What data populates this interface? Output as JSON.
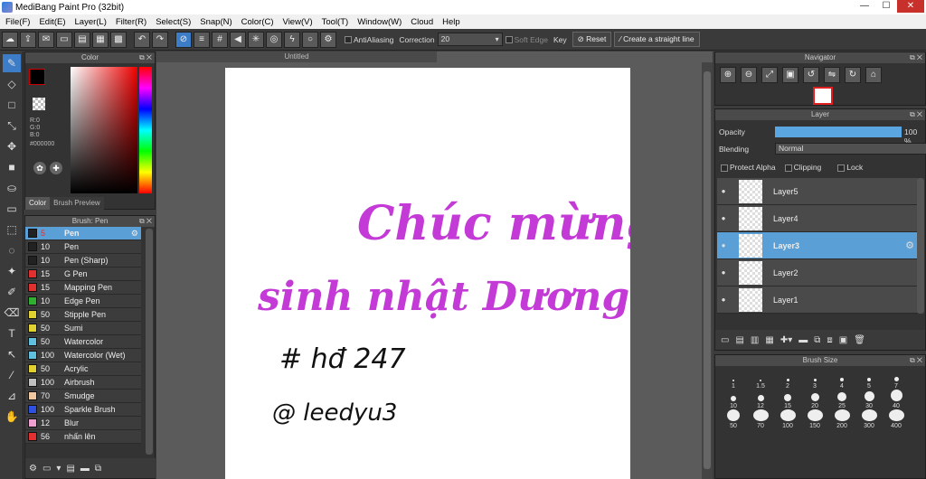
{
  "window": {
    "title": "MediBang Paint Pro (32bit)",
    "min": "—",
    "max": "☐",
    "close": "✕"
  },
  "menu": [
    "File(F)",
    "Edit(E)",
    "Layer(L)",
    "Filter(R)",
    "Select(S)",
    "Snap(N)",
    "Color(C)",
    "View(V)",
    "Tool(T)",
    "Window(W)",
    "Cloud",
    "Help"
  ],
  "toolbar": {
    "antialiasing": "AntiAliasing",
    "correction_label": "Correction",
    "correction_value": "20",
    "soft_edge": "Soft Edge",
    "key_label": "Key",
    "reset": "Reset",
    "straight_line": "Create a straight line"
  },
  "color_panel": {
    "title": "Color",
    "r": "R:0",
    "g": "G:0",
    "b": "B:0",
    "hex": "#000000",
    "tab_color": "Color",
    "tab_brush_preview": "Brush Preview"
  },
  "brush_panel": {
    "title": "Brush: Pen",
    "brushes": [
      {
        "size": "5",
        "name": "Pen",
        "color": "#222222"
      },
      {
        "size": "10",
        "name": "Pen",
        "color": "#222222"
      },
      {
        "size": "10",
        "name": "Pen (Sharp)",
        "color": "#222222"
      },
      {
        "size": "15",
        "name": "G Pen",
        "color": "#e03030"
      },
      {
        "size": "15",
        "name": "Mapping Pen",
        "color": "#e03030"
      },
      {
        "size": "10",
        "name": "Edge Pen",
        "color": "#30b030"
      },
      {
        "size": "50",
        "name": "Stipple Pen",
        "color": "#e0d030"
      },
      {
        "size": "50",
        "name": "Sumi",
        "color": "#e0d030"
      },
      {
        "size": "50",
        "name": "Watercolor",
        "color": "#60c0e0"
      },
      {
        "size": "100",
        "name": "Watercolor (Wet)",
        "color": "#60c0e0"
      },
      {
        "size": "50",
        "name": "Acrylic",
        "color": "#e0d030"
      },
      {
        "size": "100",
        "name": "Airbrush",
        "color": "#c0c0c0"
      },
      {
        "size": "70",
        "name": "Smudge",
        "color": "#f0c8a0"
      },
      {
        "size": "100",
        "name": "Sparkle Brush",
        "color": "#3050e0"
      },
      {
        "size": "12",
        "name": "Blur",
        "color": "#f0a0d0"
      },
      {
        "size": "56",
        "name": "nhấn lên",
        "color": "#e03030"
      }
    ]
  },
  "document": {
    "tab": "Untitled"
  },
  "canvas_text": {
    "line1": "Chúc mừng",
    "line2": "sinh nhật Dương",
    "line3": "# hđ 247",
    "line4": "@ leedyu3"
  },
  "navigator": {
    "title": "Navigator"
  },
  "layer_panel": {
    "title": "Layer",
    "opacity_label": "Opacity",
    "opacity_value": "100 %",
    "opacity_fraction": 1.0,
    "blending_label": "Blending",
    "blending_value": "Normal",
    "protect_alpha": "Protect Alpha",
    "clipping": "Clipping",
    "lock": "Lock",
    "layers": [
      "Layer5",
      "Layer4",
      "Layer3",
      "Layer2",
      "Layer1"
    ],
    "selected": "Layer3"
  },
  "brush_size": {
    "title": "Brush Size",
    "sizes": [
      "1",
      "1.5",
      "2",
      "3",
      "4",
      "5",
      "7",
      "10",
      "12",
      "15",
      "20",
      "25",
      "30",
      "40",
      "50",
      "70",
      "100",
      "150",
      "200",
      "300",
      "400"
    ]
  }
}
